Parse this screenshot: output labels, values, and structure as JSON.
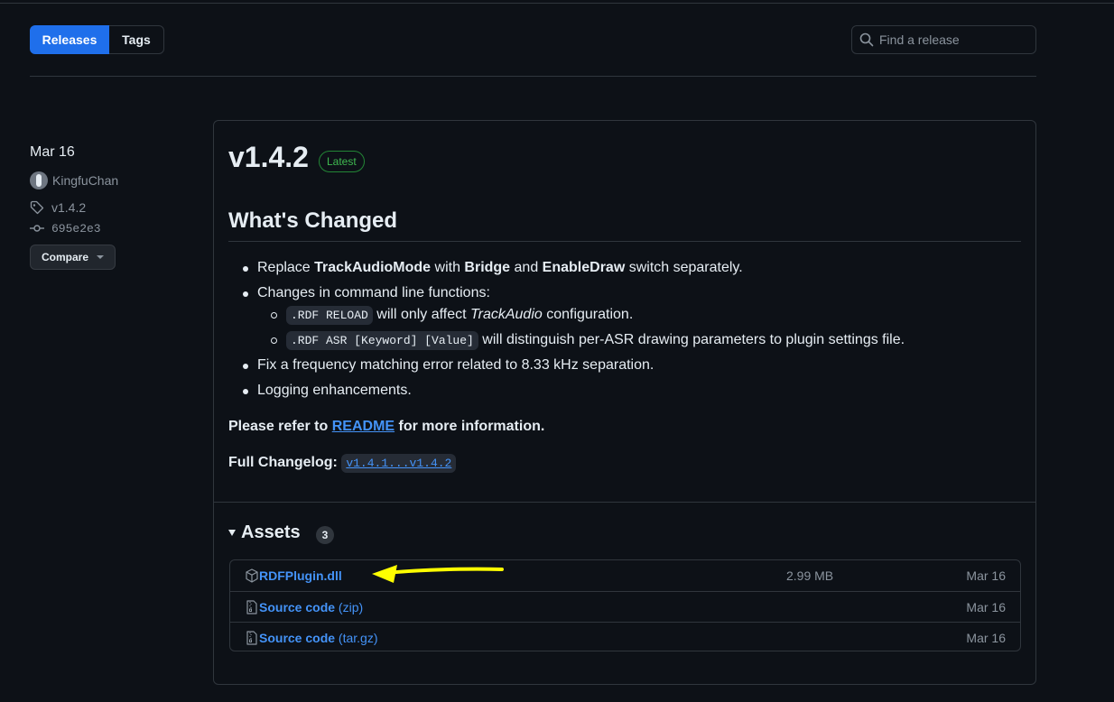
{
  "nav": {
    "tabs": [
      {
        "label": "Releases"
      },
      {
        "label": "Tags"
      }
    ],
    "search": {
      "placeholder": "Find a release"
    }
  },
  "sidebar": {
    "date": "Mar 16",
    "author": "KingfuChan",
    "tag": "v1.4.2",
    "commit": "695e2e3",
    "compare_label": "Compare"
  },
  "release": {
    "version": "v1.4.2",
    "badge": "Latest",
    "heading": "What's Changed",
    "changes": {
      "item1": {
        "t1": "Replace ",
        "b1": "TrackAudioMode",
        "t2": " with ",
        "b2": "Bridge",
        "t3": " and ",
        "b3": "EnableDraw",
        "t4": " switch separately."
      },
      "item2": {
        "text": "Changes in command line functions:"
      },
      "sub1": {
        "code": ".RDF RELOAD",
        "t1": " will only affect ",
        "em": "TrackAudio",
        "t2": " configuration."
      },
      "sub2": {
        "code": ".RDF ASR [Keyword] [Value]",
        "t1": " will distinguish per-ASR drawing parameters to plugin settings file."
      },
      "item3": {
        "text": "Fix a frequency matching error related to 8.33 kHz separation."
      },
      "item4": {
        "text": "Logging enhancements."
      }
    },
    "refer": {
      "pre": "Please refer to ",
      "link": "README",
      "post": " for more information."
    },
    "changelog": {
      "label": "Full Changelog",
      "colon": ": ",
      "link": "v1.4.1...v1.4.2"
    }
  },
  "assets": {
    "title": "Assets",
    "count": "3",
    "items": [
      {
        "name": "RDFPlugin.dll",
        "ext": "",
        "size": "2.99 MB",
        "date": "Mar 16",
        "icon": "package-icon"
      },
      {
        "name": "Source code",
        "ext": " (zip)",
        "size": "",
        "date": "Mar 16",
        "icon": "file-zip-icon"
      },
      {
        "name": "Source code",
        "ext": " (tar.gz)",
        "size": "",
        "date": "Mar 16",
        "icon": "file-zip-icon"
      }
    ]
  },
  "colors": {
    "accent": "#1f6feb",
    "link": "#4493f8",
    "badge_green": "#3fb950",
    "annotation_arrow": "#ffff00",
    "background": "#0d1117"
  }
}
